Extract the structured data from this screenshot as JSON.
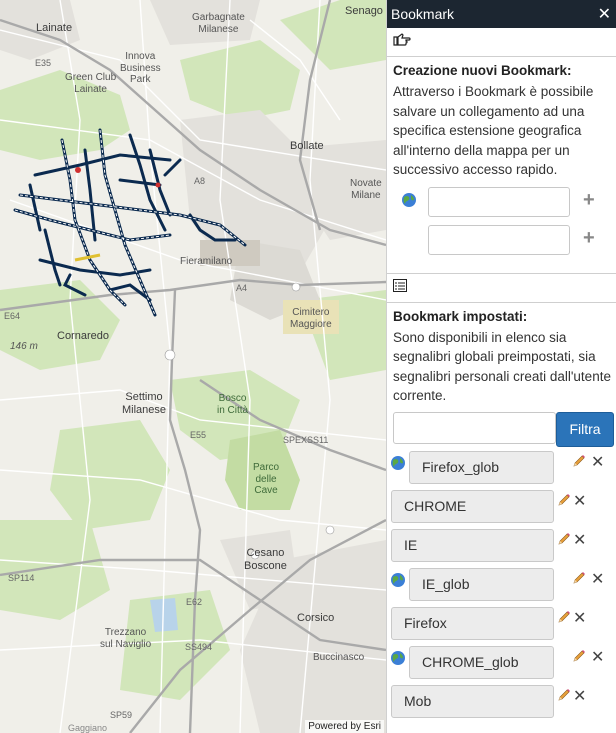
{
  "map": {
    "labels": {
      "senago": "Senago",
      "lainate": "Lainate",
      "garbagnate": "Garbagnate\nMilanese",
      "innova": "Innova\nBusiness\nPark",
      "greenclub": "Green Club\nLainate",
      "bollate": "Bollate",
      "novate": "Novate\nMilane",
      "fieramilano": "Fieramilano",
      "cimitero": "Cimitero\nMaggiore",
      "cornaredo": "Cornaredo",
      "elev": "146 m",
      "settimo": "Settimo\nMilanese",
      "bosco": "Bosco\nin Città",
      "parco": "Parco\ndelle\nCave",
      "cesano": "Cesano\nBoscone",
      "corsico": "Corsico",
      "trezzano": "Trezzano\nsul Naviglio",
      "buccinasco": "Buccinasco",
      "gaggiano": "Gaggiano",
      "a8": "A8",
      "a4": "A4",
      "e35": "E35",
      "e64": "E64",
      "e55": "E55",
      "e62": "E62",
      "sp114": "SP114",
      "ss494": "SS494",
      "spexss11": "SPEXSS11",
      "sp59": "SP59"
    },
    "attribution": "Powered by Esri"
  },
  "panel": {
    "title": "Bookmark",
    "close": "✕",
    "create_heading": "Creazione nuovi Bookmark:",
    "create_desc": "Attraverso i Bookmark è possibile salvare un collegamento ad una specifica estensione geografica all'interno della mappa per un successivo accesso rapido.",
    "new_global_value": "",
    "new_personal_value": "",
    "set_heading": "Bookmark impostati:",
    "set_desc": "Sono disponibili in elenco sia segnalibri globali preimpostati, sia segnalibri personali creati dall'utente corrente.",
    "filter_value": "",
    "filter_button": "Filtra",
    "bookmarks": [
      {
        "label": "Firefox_glob",
        "global": true
      },
      {
        "label": "CHROME",
        "global": false
      },
      {
        "label": "IE",
        "global": false
      },
      {
        "label": "IE_glob",
        "global": true
      },
      {
        "label": "Firefox",
        "global": false
      },
      {
        "label": "CHROME_glob",
        "global": true
      },
      {
        "label": "Mob",
        "global": false
      }
    ]
  },
  "colors": {
    "titlebar": "#1c2631",
    "filter_button": "#2b74b9",
    "map_background": "#f0efe9",
    "park_green": "#cfe3b5",
    "network_blue": "#0b2a4f"
  },
  "icons": {
    "bookmark_hand": "pointing-hand-icon",
    "list": "list-icon",
    "globe": "globe-icon",
    "plus": "plus-icon",
    "edit": "pencil-icon",
    "delete": "close-icon"
  }
}
